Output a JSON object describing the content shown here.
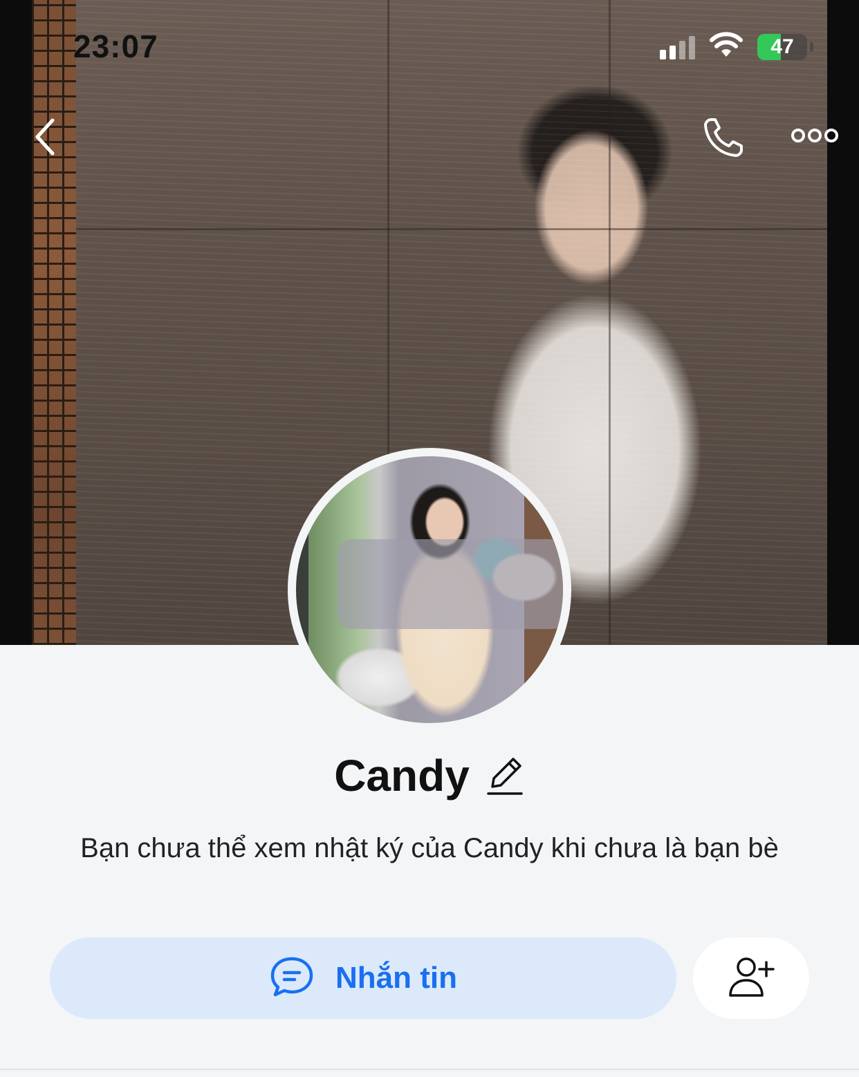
{
  "status_bar": {
    "time": "23:07",
    "battery": "47",
    "battery_level": 0.47,
    "signal_bars_active": 2,
    "signal_bars_total": 4,
    "icons": [
      "cellular-signal-icon",
      "wifi-icon",
      "battery-charging-icon"
    ]
  },
  "nav": {
    "icons": [
      "back-chevron-icon",
      "phone-call-icon",
      "more-options-icon"
    ]
  },
  "profile": {
    "name": "Candy",
    "edit_icon": "pencil-icon",
    "notice": "Bạn chưa thể xem nhật ký của Candy khi chưa là bạn bè"
  },
  "actions": {
    "message_label": "Nhắn tin",
    "message_icon": "chat-bubble-icon",
    "add_friend_icon": "add-friend-icon"
  },
  "colors": {
    "accent": "#1a6ff0",
    "message_button_bg": "#dbe9fb",
    "page_bg": "#f4f5f7",
    "battery_green": "#34c759"
  }
}
